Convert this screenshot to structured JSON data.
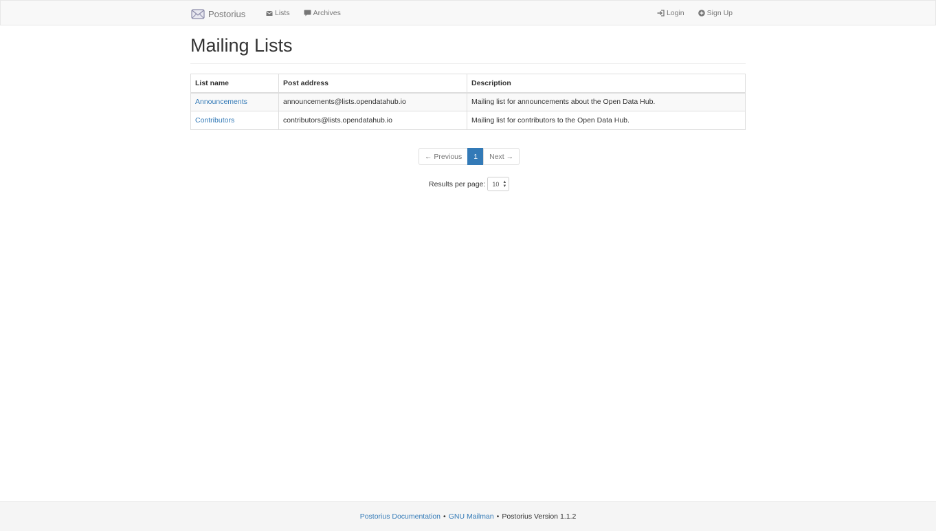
{
  "navbar": {
    "brand": "Postorius",
    "lists": "Lists",
    "archives": "Archives",
    "login": "Login",
    "signup": "Sign Up"
  },
  "page": {
    "title": "Mailing Lists"
  },
  "table": {
    "headers": [
      "List name",
      "Post address",
      "Description"
    ],
    "rows": [
      {
        "name": "Announcements",
        "address": "announcements@lists.opendatahub.io",
        "description": "Mailing list for announcements about the Open Data Hub."
      },
      {
        "name": "Contributors",
        "address": "contributors@lists.opendatahub.io",
        "description": "Mailing list for contributors to the Open Data Hub."
      }
    ]
  },
  "pagination": {
    "previous": "← Previous",
    "current": "1",
    "next": "Next →",
    "per_page_label": "Results per page:",
    "per_page_value": "10"
  },
  "footer": {
    "docs": "Postorius Documentation",
    "bullet": "•",
    "mailman": "GNU Mailman",
    "version": "Postorius Version 1.1.2"
  },
  "colors": {
    "link": "#337ab7",
    "active_page": "#337ab7"
  }
}
